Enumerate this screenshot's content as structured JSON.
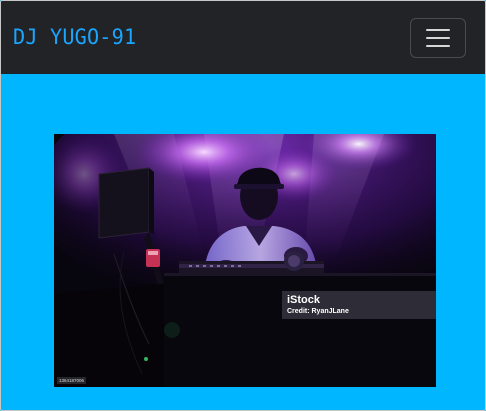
{
  "navbar": {
    "brand": "DJ YUGO-91",
    "toggler_icon": "hamburger-menu-icon"
  },
  "hero": {
    "image_subject": "dj-performing-image",
    "watermark": {
      "logo": "iStock",
      "credit": "Credit: RyanJLane",
      "tag": "1364187006"
    }
  },
  "colors": {
    "page_background": "#00b6ff",
    "navbar_background": "#222327",
    "brand_text": "#1aa6ff"
  }
}
